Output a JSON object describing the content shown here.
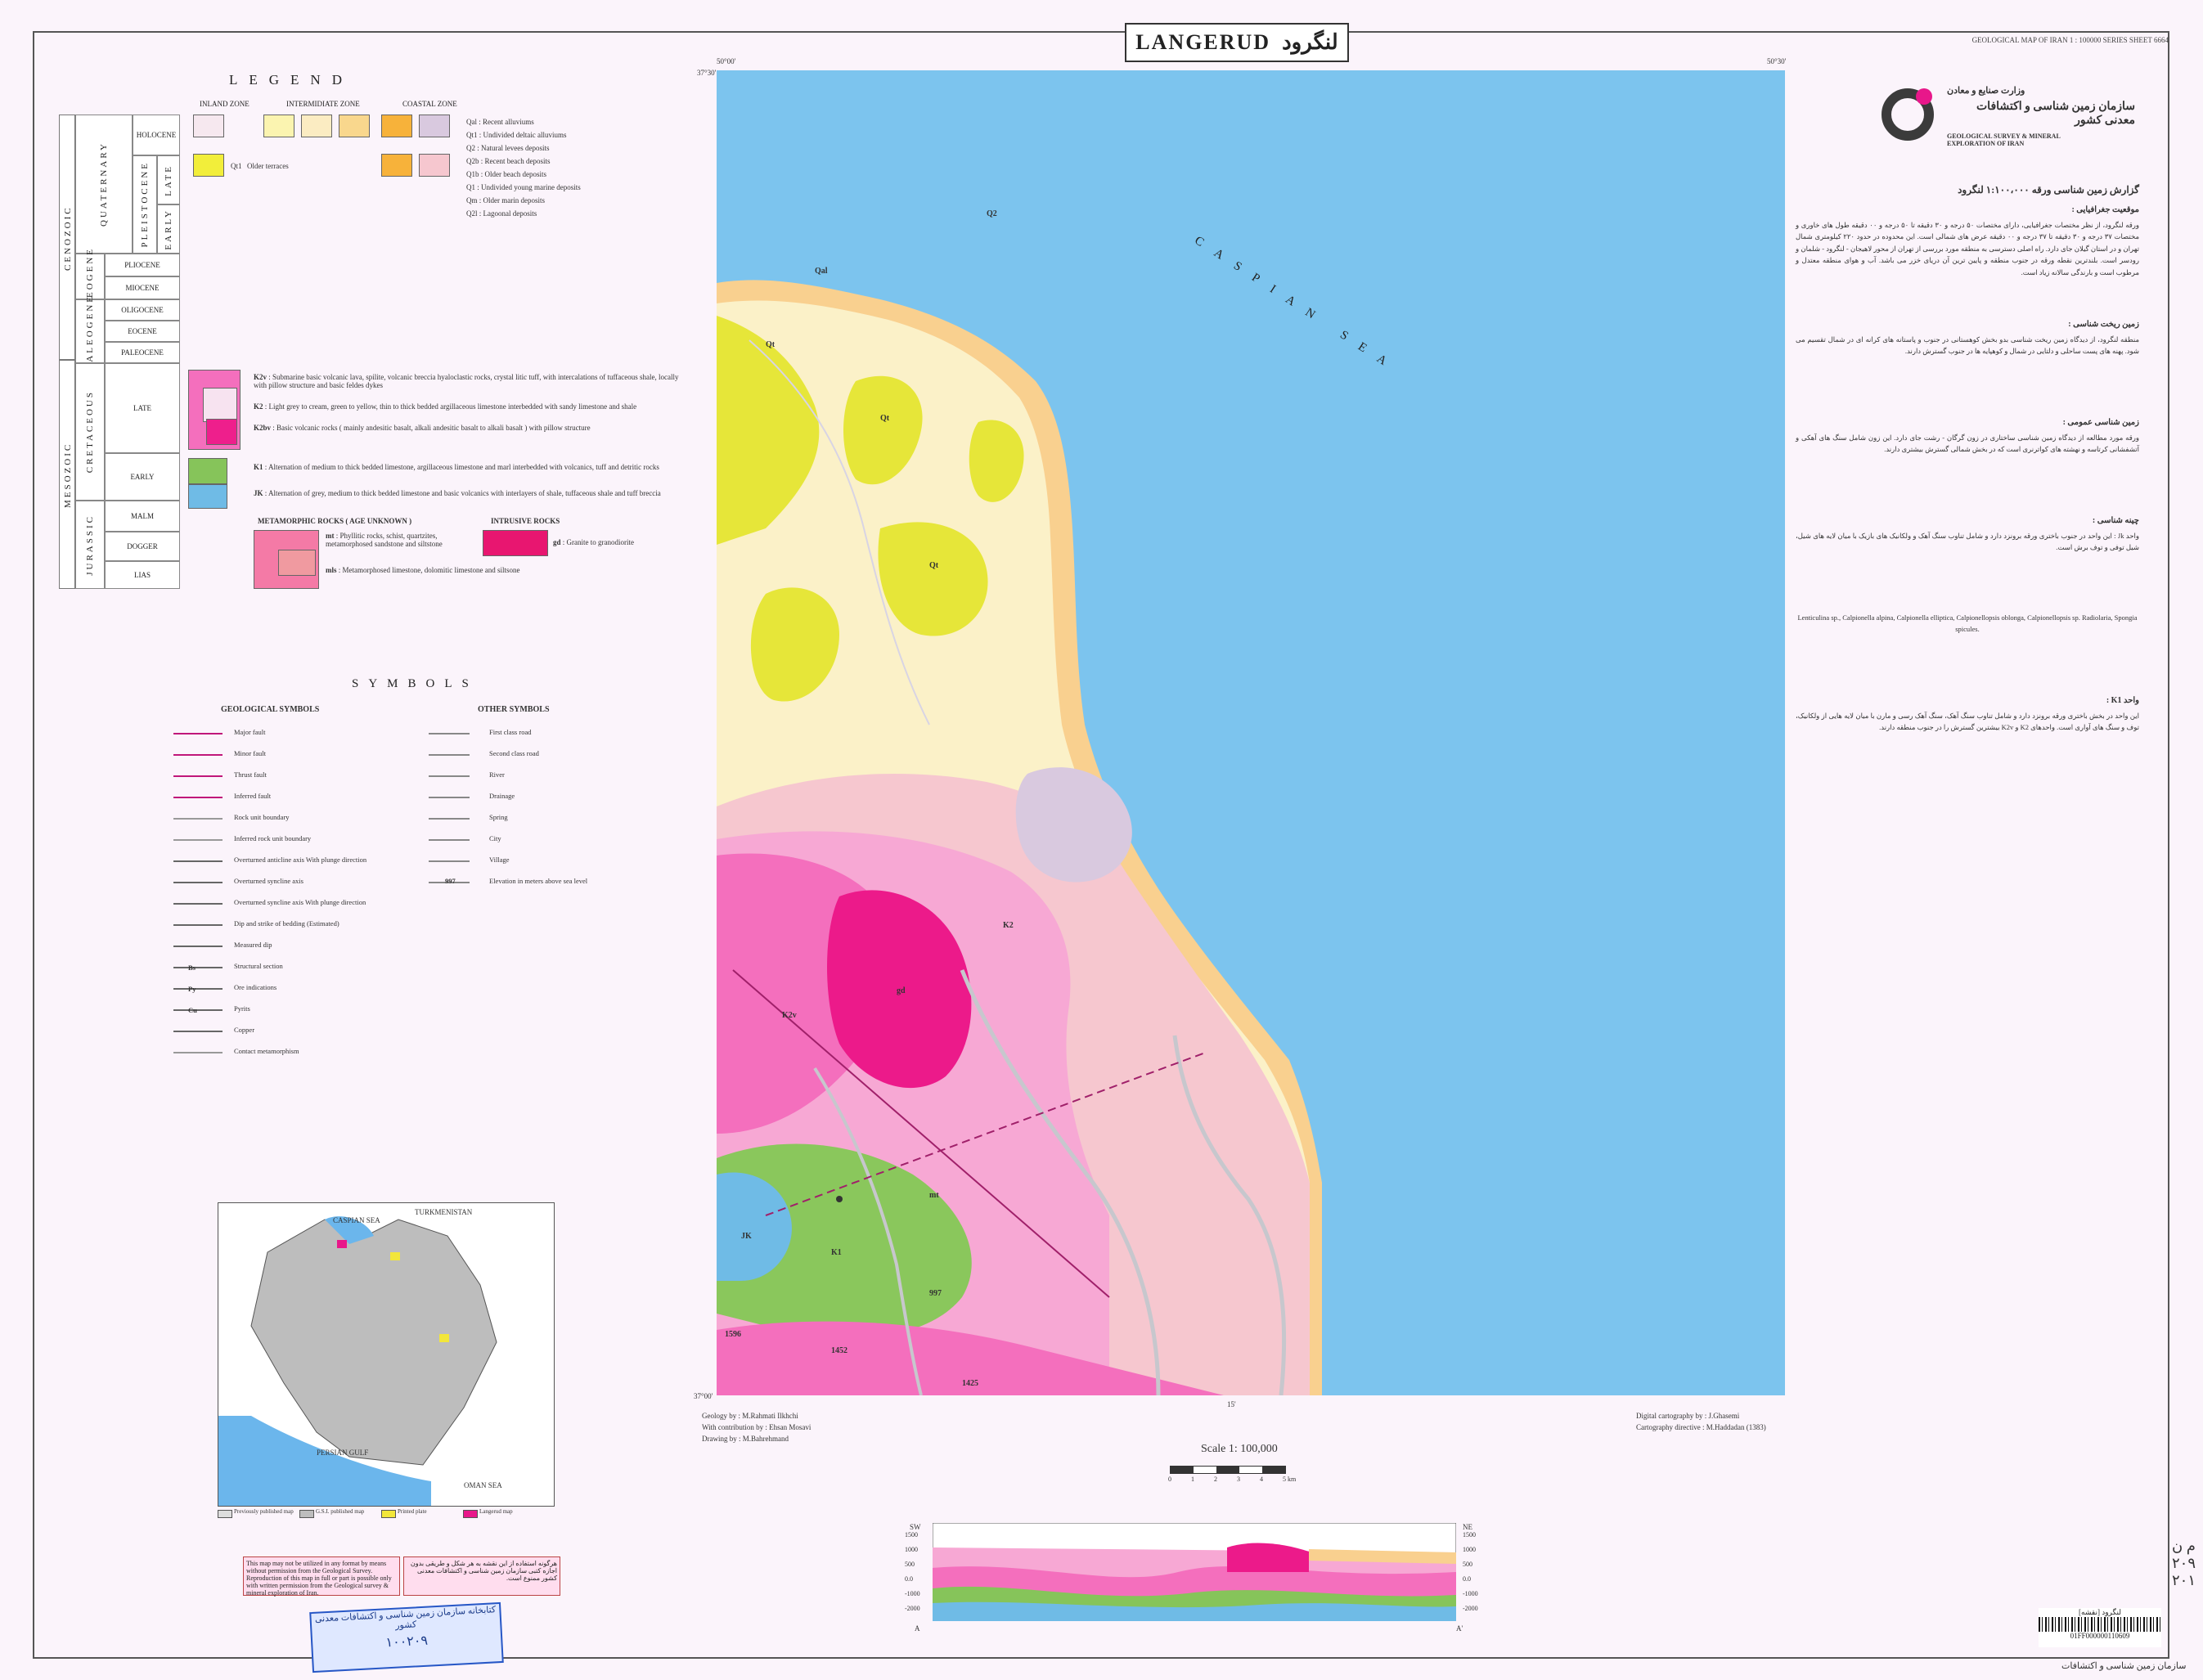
{
  "sheet": {
    "title_en": "LANGERUD",
    "title_fa": "لنگرود",
    "series": "GEOLOGICAL MAP OF IRAN 1 : 100000 SERIES SHEET 6664"
  },
  "legend": {
    "title": "LEGEND",
    "zones": [
      "INLAND ZONE",
      "INTERMIDIATE ZONE",
      "COASTAL ZONE"
    ],
    "eras": {
      "cenozoic": "CENOZOIC",
      "mesozoic": "MESOZOIC"
    },
    "periods": [
      "QUATERNARY",
      "NEOGENE",
      "PALEOGENE",
      "CRETACEOUS",
      "JURASSIC"
    ],
    "epochs": [
      "HOLOCENE",
      "PLEISTOCENE",
      "LATE",
      "EARLY",
      "PLIOCENE",
      "MIOCENE",
      "OLIGOCENE",
      "EOCENE",
      "PALEOCENE",
      "LATE",
      "EARLY",
      "MALM",
      "DOGGER",
      "LIAS"
    ],
    "quaternary_units": [
      {
        "code": "Qal",
        "text": "Recent alluviums",
        "color": "#f6e8ef"
      },
      {
        "code": "Qt1",
        "text": "Undivided deltaic alluviums",
        "color": "#fbf4b0"
      },
      {
        "code": "Q2",
        "text": "Natural levees deposits",
        "color": "#fbecc2"
      },
      {
        "code": "Q2b",
        "text": "Recent beach deposits",
        "color": "#f9d78d"
      },
      {
        "code": "Q1b",
        "text": "Older beach deposits",
        "color": "#f7b23a"
      },
      {
        "code": "Q1",
        "text": "Undivided young marine deposits",
        "color": "#f6c7cf"
      },
      {
        "code": "Qm",
        "text": "Older marin deposits",
        "color": "#e8c2d6"
      },
      {
        "code": "Q2l",
        "text": "Lagoonal deposits",
        "color": "#d9c9df"
      }
    ],
    "older_terraces": {
      "code": "Qt1",
      "text": "Older terraces",
      "color": "#f2ee3a"
    },
    "cretaceous_units": [
      {
        "code": "K2v",
        "text": "Submarine basic volcanic lava, spilite, volcanic breccia hyaloclastic rocks, crystal litic tuff, with intercalations of tuffaceous shale, locally with pillow structure and basic feldes dykes",
        "color": "#f46fbd"
      },
      {
        "code": "K2",
        "text": "Light grey to cream, green to yellow, thin to thick bedded argillaceous limestone interbedded with sandy limestone and shale",
        "color": "#f7a8d4"
      },
      {
        "code": "K2bv",
        "text": "Basic volcanic rocks ( mainly andesitic basalt, alkali andesitic basalt to alkali basalt ) with pillow structure",
        "color": "#ee1f8c"
      },
      {
        "code": "K1",
        "text": "Alternation of medium to thick bedded limestone, argillaceous limestone and marl interbedded with volcanics, tuff and detritic rocks",
        "color": "#86c45a"
      },
      {
        "code": "JK",
        "text": "Alternation of grey, medium to thick bedded limestone and basic volcanics with interlayers of shale, tuffaceous shale and tuff breccia",
        "color": "#6fbbe6"
      }
    ],
    "metamorphic": {
      "title": "METAMORPHIC ROCKS ( AGE UNKNOWN )",
      "items": [
        {
          "code": "mt",
          "text": "Phyllitic rocks, schist, quartzites, metamorphosed sandstone and siltstone",
          "color": "#f47aa6"
        },
        {
          "code": "mls",
          "text": "Metamorphosed limestone, dolomitic limestone and siltsone",
          "color": "#f09aa0"
        }
      ]
    },
    "intrusive": {
      "title": "INTRUSIVE ROCKS",
      "items": [
        {
          "code": "gd",
          "text": "Granite to granodiorite",
          "color": "#e81670"
        }
      ]
    }
  },
  "symbols": {
    "title": "SYMBOLS",
    "geological_title": "GEOLOGICAL SYMBOLS",
    "other_title": "OTHER SYMBOLS",
    "geological": [
      "Major fault",
      "Minor fault",
      "Thrust fault",
      "Inferred fault",
      "Rock unit boundary",
      "Inferred rock unit boundary",
      "Overturned anticline axis With plunge direction",
      "Overturned syncline axis",
      "Overturned syncline axis With plunge direction",
      "Dip and strike of bedding (Estimated)",
      "Measured dip",
      "Structural section",
      "Ore indications",
      "Pyrits",
      "Copper",
      "Contact metamorphism"
    ],
    "geological_codes": [
      "Bs",
      "Py",
      "Cu"
    ],
    "other": [
      "First class road",
      "Second class road",
      "River",
      "Drainage",
      "Spring",
      "City",
      "Village",
      "Elevation in meters above sea level"
    ],
    "elevation_example": "997"
  },
  "map": {
    "sea_label": "CASPIAN SEA",
    "coords": {
      "tl_lon": "50°00'",
      "tr_lon": "50°30'",
      "lat_top": "37°30'",
      "lat_bottom": "37°00'",
      "mid": "15'"
    },
    "colors": {
      "sea": "#7cc4ee",
      "alluvium": "#fbf1c8",
      "young_marine": "#f6c7cf",
      "beach": "#f9d08f",
      "terrace": "#e6e639",
      "k2": "#f7a8d4",
      "k2v": "#f46fbd",
      "gd": "#ec1a8a",
      "k1": "#8ac75c",
      "jk": "#6fbbe6",
      "river": "#c7c7cd"
    },
    "unit_labels": [
      "Qt",
      "Qt",
      "Qt",
      "Qal",
      "Q2",
      "K2",
      "K2v",
      "gd",
      "JK",
      "K1",
      "mt",
      "997",
      "1452",
      "1425",
      "1596"
    ]
  },
  "credits": {
    "geology_by": "Geology by : M.Rahmati Ilkhchi",
    "contribution": "With contribution by : Ehsan Mosavi",
    "drawing_by": "Drawing by : M.Bahrehmand",
    "digital": "Digital cartography by : J.Ghasemi",
    "directive": "Cartography directive : M.Haddadan (1383)",
    "scale_text": "Scale 1: 100,000",
    "scale_ticks": [
      "0",
      "1",
      "2",
      "3",
      "4",
      "5 km"
    ]
  },
  "section": {
    "labels": [
      "SW",
      "NE",
      "A",
      "A'"
    ],
    "ticks": [
      "1500",
      "1000",
      "500",
      "0.0",
      "-1000",
      "-2000"
    ]
  },
  "org": {
    "fa_title": "وزارت صنایع و معادن",
    "fa_name": "سازمان زمین شناسی و اکتشافات معدنی کشور",
    "en_name": "GEOLOGICAL SURVEY & MINERAL EXPLORATION OF IRAN",
    "logo_colors": {
      "ring": "#3b3b3b",
      "dot": "#e8178a"
    }
  },
  "report": {
    "heading": "گزارش زمین شناسی ورقه ۱:۱۰۰،۰۰۰ لنگرود",
    "sections": [
      {
        "title": "موقعیت جغرافیایی :",
        "body": "ورقه لنگرود، از نظر مختصات جغرافیایی، دارای مختصات ۵۰ درجه و ۳۰ دقیقه تا ۵۰ درجه و ۰۰ دقیقه طول های خاوری و مختصات ۳۷ درجه و ۳۰ دقیقه تا ۳۷ درجه و ۰۰ دقیقه عرض های شمالی است. این محدوده در حدود ۲۲۰ کیلومتری شمال تهران و در استان گیلان جای دارد. راه اصلی دسترسی به منطقه مورد بررسی از تهران از محور لاهیجان - لنگرود - شلمان و رودسر است. بلندترین نقطه ورقه در جنوب منطقه و پایین ترین آن دریای خزر می باشد. آب و هوای منطقه معتدل و مرطوب است و بارندگی سالانه زیاد است."
      },
      {
        "title": "زمین ریخت شناسی :",
        "body": "منطقه لنگرود، از دیدگاه زمین ریخت شناسی بدو بخش کوهستانی در جنوب و پاستانه های کرانه ای در شمال تقسیم می شود. پهنه های پست ساحلی و دلتایی در شمال و کوهپایه ها در جنوب گسترش دارند."
      },
      {
        "title": "زمین شناسی عمومی :",
        "body": "ورقه مورد مطالعه از دیدگاه زمین شناسی ساختاری در زون گرگان - رشت جای دارد. این زون شامل سنگ های آهکی و آتشفشانی کرتاسه و نهشته های کواترنری است که در بخش شمالی گسترش بیشتری دارند."
      },
      {
        "title": "چینه شناسی :",
        "body": "واحد Jk : این واحد در جنوب باختری ورقه برونزد دارد و شامل تناوب سنگ آهک و ولکانیک های بازیک با میان لایه های شیل، شیل توفی و توف برش است."
      },
      {
        "title": "",
        "body": "Lenticulina sp., Calpionella alpina, Calpionella elliptica, Calpionellopsis oblonga, Calpionellopsis sp. Radiolaria, Spongia spicules."
      },
      {
        "title": "واحد K1 :",
        "body": "این واحد در بخش باختری ورقه برونزد دارد و شامل تناوب سنگ آهک، سنگ آهک رسی و مارن با میان لایه هایی از ولکانیک، توف و سنگ های آواری است. واحدهای K2 و K2v بیشترین گسترش را در جنوب منطقه دارند."
      }
    ]
  },
  "inset": {
    "labels": [
      "CASPIAN SEA",
      "TURKMENISTAN",
      "PERSIAN GULF",
      "OMAN SEA"
    ],
    "legend": [
      "Previously published map",
      "G.S.I. published map",
      "Printed plate",
      "Langerud map"
    ]
  },
  "notice_en": "This map may not be utilized in any format by means without permission from the Geological Survey. Reproduction of this map in full or part is possible only with written permission from the Geological survey & mineral exploration of Iran.",
  "notice_fa": "هرگونه استفاده از این نقشه به هر شکل و طریقی بدون اجازه کتبی سازمان زمین شناسی و اکتشافات معدنی کشور ممنوع است.",
  "stamp": {
    "line1": "کتابخانه سازمان زمین شناسی و اکتشافات معدنی کشور",
    "line2": "۱۰۰۲۰۹"
  },
  "barcode": {
    "label": "لنگرود [نقشه]",
    "code": "01FF000000110609",
    "caption": "سازمان زمین شناسی و اکتشافات"
  },
  "handwriting": "م ن ۲۰۹ ۲۰۱"
}
